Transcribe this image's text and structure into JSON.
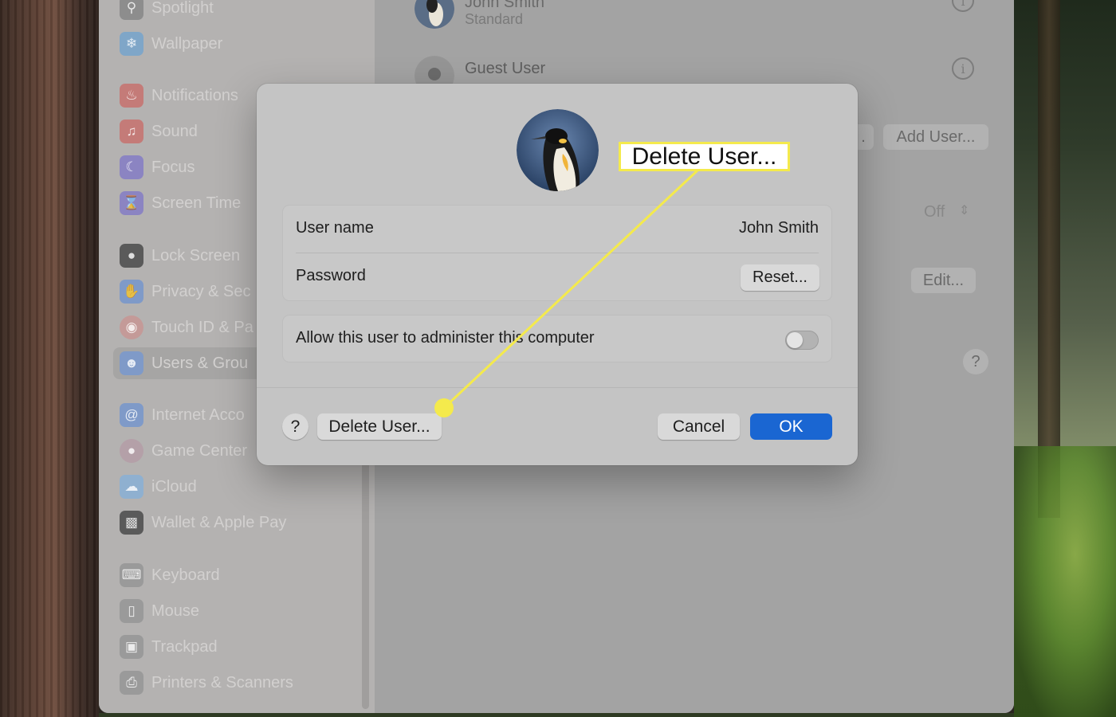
{
  "sidebar": {
    "items": [
      {
        "label": "Spotlight",
        "icon": "search-icon",
        "color": "#8d8d8d"
      },
      {
        "label": "Wallpaper",
        "icon": "wallpaper-icon",
        "color": "#7fa6c8"
      },
      {
        "label": "Notifications",
        "icon": "bell-icon",
        "color": "#c47b78"
      },
      {
        "label": "Sound",
        "icon": "speaker-icon",
        "color": "#c47b78"
      },
      {
        "label": "Focus",
        "icon": "moon-icon",
        "color": "#8b84c2"
      },
      {
        "label": "Screen Time",
        "icon": "hourglass-icon",
        "color": "#8b84c2"
      },
      {
        "label": "Lock Screen",
        "icon": "lock-icon",
        "color": "#5a5a5a"
      },
      {
        "label": "Privacy & Sec",
        "icon": "hand-icon",
        "color": "#7f9ac8"
      },
      {
        "label": "Touch ID & Pa",
        "icon": "fingerprint-icon",
        "color": "#c49a98"
      },
      {
        "label": "Users & Grou",
        "icon": "users-icon",
        "color": "#7f9ac8"
      },
      {
        "label": "Internet Acco",
        "icon": "at-icon",
        "color": "#7f9ac8"
      },
      {
        "label": "Game Center",
        "icon": "game-center-icon",
        "color": "#b4a0a8"
      },
      {
        "label": "iCloud",
        "icon": "cloud-icon",
        "color": "#8fb0d0"
      },
      {
        "label": "Wallet & Apple Pay",
        "icon": "wallet-icon",
        "color": "#5a5a5a"
      },
      {
        "label": "Keyboard",
        "icon": "keyboard-icon",
        "color": "#9a9a9a"
      },
      {
        "label": "Mouse",
        "icon": "mouse-icon",
        "color": "#9a9a9a"
      },
      {
        "label": "Trackpad",
        "icon": "trackpad-icon",
        "color": "#9a9a9a"
      },
      {
        "label": "Printers & Scanners",
        "icon": "printer-icon",
        "color": "#9a9a9a"
      }
    ]
  },
  "content": {
    "current_user_name": "John Smith",
    "current_user_role": "Standard",
    "guest_user_label": "Guest User",
    "add_user_label": "Add User...",
    "off_value": "Off",
    "edit_label": "Edit...",
    "help_label": "?"
  },
  "dialog": {
    "username_label": "User name",
    "username_value": "John Smith",
    "password_label": "Password",
    "reset_label": "Reset...",
    "admin_label": "Allow this user to administer this computer",
    "admin_enabled": false,
    "help_label": "?",
    "delete_label": "Delete User...",
    "cancel_label": "Cancel",
    "ok_label": "OK"
  },
  "annotation": {
    "callout_text": "Delete User...",
    "highlight_color": "#f4ea4c"
  },
  "colors": {
    "accent": "#1a66d2"
  }
}
